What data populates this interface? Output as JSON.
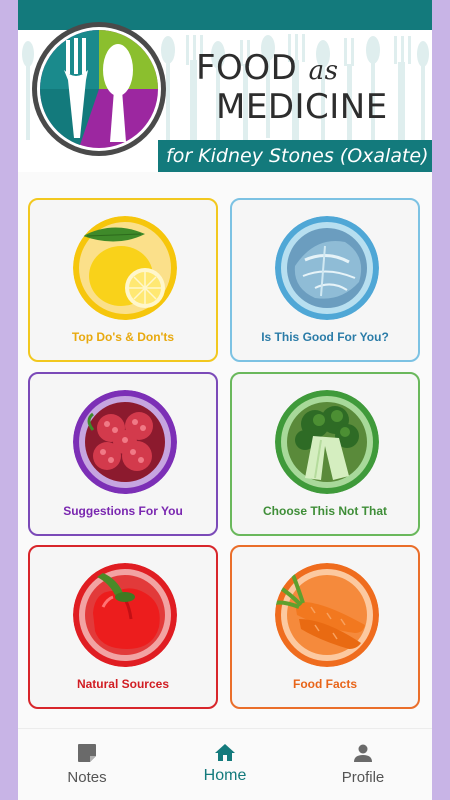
{
  "header": {
    "title_food": "FOOD",
    "title_as": "as",
    "title_medicine": "MEDICINE",
    "subtitle": "for Kidney Stones (Oxalate)",
    "teal_color": "#137a7c"
  },
  "tiles": [
    {
      "label": "Top Do's & Don'ts",
      "icon": "lemon-icon",
      "border_color": "#f2c81f"
    },
    {
      "label": "Is This Good For You?",
      "icon": "cabbage-icon",
      "border_color": "#7cc2e3"
    },
    {
      "label": "Suggestions For You",
      "icon": "raspberry-icon",
      "border_color": "#7b4ab8"
    },
    {
      "label": "Choose This Not That",
      "icon": "broccoli-icon",
      "border_color": "#6ab85c"
    },
    {
      "label": "Natural Sources",
      "icon": "pepper-icon",
      "border_color": "#d8262b"
    },
    {
      "label": "Food Facts",
      "icon": "carrot-icon",
      "border_color": "#ea6e2a"
    }
  ],
  "nav": {
    "items": [
      {
        "label": "Notes",
        "icon": "note-icon"
      },
      {
        "label": "Home",
        "icon": "home-icon",
        "active": true
      },
      {
        "label": "Profile",
        "icon": "person-icon"
      }
    ],
    "active_color": "#137a7c"
  }
}
